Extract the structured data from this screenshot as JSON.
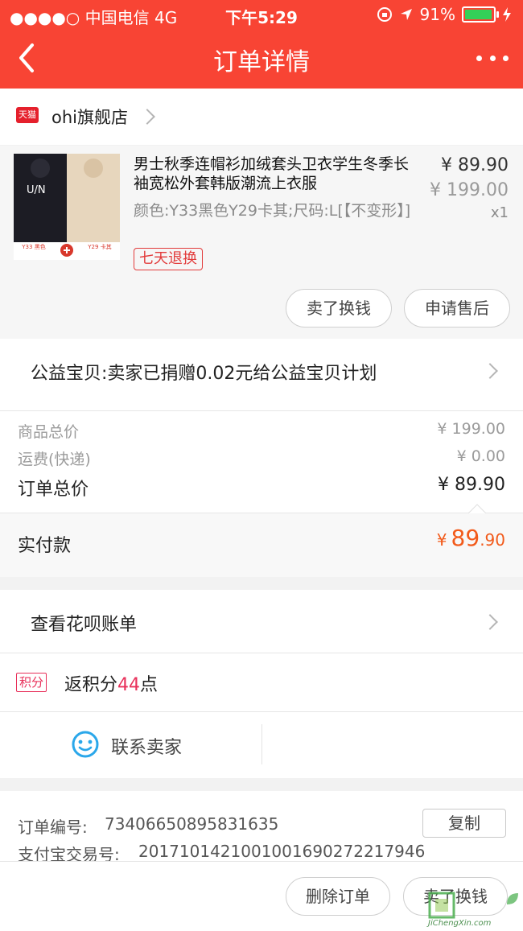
{
  "status_bar": {
    "carrier": "●●●●○ 中国电信  4G",
    "time": "下午5:29",
    "battery": "91%"
  },
  "nav": {
    "title": "订单详情"
  },
  "shop": {
    "badge": "天猫",
    "name": "ohi旗舰店"
  },
  "product": {
    "title": "男士秋季连帽衫加绒套头卫衣学生冬季长袖宽松外套韩版潮流上衣服",
    "spec": "颜色:Y33黑色Y29卡其;尺码:L[【不变形】]",
    "price_now": "¥ 89.90",
    "price_old": "¥ 199.00",
    "qty": "x1",
    "return_badge": "七天退换",
    "thumb_labels": {
      "left_text": "U/N",
      "left_caption": "Y33 黑色",
      "right_caption": "Y29 卡其"
    }
  },
  "actions": {
    "sell_exchange": "卖了换钱",
    "after_sale": "申请售后"
  },
  "charity": {
    "text": "公益宝贝:卖家已捐赠0.02元给公益宝贝计划"
  },
  "price_summary": {
    "goods_total_label": "商品总价",
    "goods_total": "¥ 199.00",
    "shipping_label": "运费(快递)",
    "shipping": "¥ 0.00",
    "order_total_label": "订单总价",
    "order_total": "¥ 89.90",
    "paid_label": "实付款",
    "paid_currency": "¥",
    "paid_int": "89",
    "paid_dec": ".90"
  },
  "huabei": {
    "label": "查看花呗账单"
  },
  "points": {
    "badge": "积分",
    "prefix": "返积分",
    "number": "44",
    "suffix": "点"
  },
  "contact": {
    "label": "联系卖家"
  },
  "order_info": {
    "order_no_label": "订单编号:",
    "order_no": "73406650895831635",
    "copy_button": "复制",
    "alipay_label": "支付宝交易号:",
    "alipay_no": "2017101421001001690272217946"
  },
  "bottom": {
    "delete_order": "删除订单",
    "sell_exchange": "卖了换钱"
  },
  "watermark": {
    "text": "JiChengXin.com"
  },
  "colors": {
    "header_red": "#f84434",
    "price_orange": "#f25a1a",
    "badge_red": "#e23b3b",
    "tmall_red": "#e5202c",
    "points_pink": "#e8305a",
    "chat_blue": "#2aa7ea"
  }
}
